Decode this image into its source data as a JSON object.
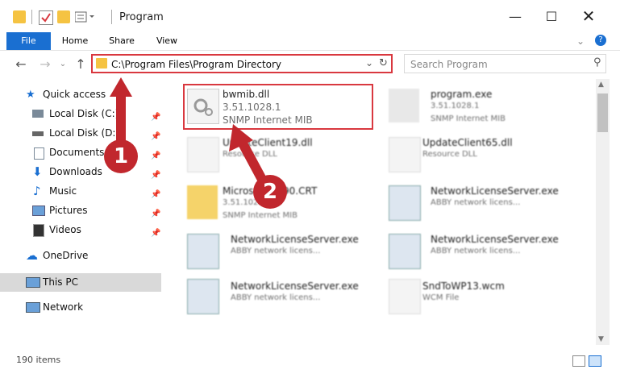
{
  "window": {
    "title": "Program"
  },
  "ribbon": {
    "tabs": [
      "File",
      "Home",
      "Share",
      "View"
    ]
  },
  "address": {
    "path": "C:\\Program Files\\Program Directory"
  },
  "search": {
    "placeholder": "Search Program"
  },
  "sidebar": {
    "quick_access": "Quick access",
    "items": [
      {
        "label": "Local Disk (C:)",
        "icon": "drive-icon"
      },
      {
        "label": "Local Disk (D:)",
        "icon": "drive-icon"
      },
      {
        "label": "Documents",
        "icon": "documents-icon"
      },
      {
        "label": "Downloads",
        "icon": "downloads-icon"
      },
      {
        "label": "Music",
        "icon": "music-icon"
      },
      {
        "label": "Pictures",
        "icon": "pictures-icon"
      },
      {
        "label": "Videos",
        "icon": "videos-icon"
      }
    ],
    "onedrive": "OneDrive",
    "thispc": "This PC",
    "network": "Network"
  },
  "files": [
    {
      "name": "bwmib.dll",
      "line2": "3.51.1028.1",
      "line3": "SNMP Internet MIB"
    },
    {
      "name": "program.exe",
      "line2": "3.51.1028.1",
      "line3": "SNMP Internet MIB"
    },
    {
      "name": "UpdateClient19.dll",
      "line2": "Resource DLL",
      "line3": ""
    },
    {
      "name": "UpdateClient65.dll",
      "line2": "Resource DLL",
      "line3": ""
    },
    {
      "name": "Microsoft.VC90.CRT",
      "line2": "3.51.1028.1",
      "line3": "SNMP Internet MIB"
    },
    {
      "name": "NetworkLicenseServer.exe",
      "line2": "ABBY network licens...",
      "line3": ""
    },
    {
      "name": "NetworkLicenseServer.exe",
      "line2": "ABBY network licens...",
      "line3": ""
    },
    {
      "name": "NetworkLicenseServer.exe",
      "line2": "ABBY network licens...",
      "line3": ""
    },
    {
      "name": "NetworkLicenseServer.exe",
      "line2": "ABBY network licens...",
      "line3": ""
    },
    {
      "name": "SndToWP13.wcm",
      "line2": "WCM File",
      "line3": ""
    }
  ],
  "status": {
    "count": "190 items"
  },
  "annotations": {
    "badge1": "1",
    "badge2": "2"
  },
  "colors": {
    "accent": "#1a6fd1",
    "highlight": "#d9383f"
  }
}
